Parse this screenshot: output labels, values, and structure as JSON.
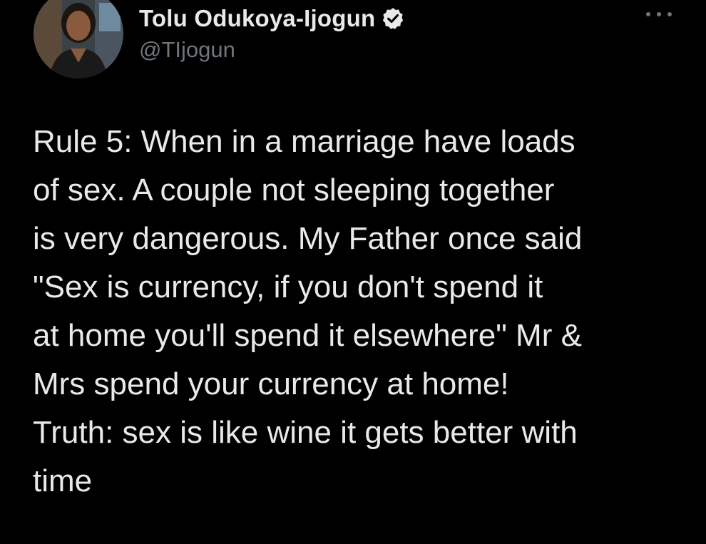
{
  "author": {
    "display_name": "Tolu Odukoya-Ijogun",
    "handle": "@TIjogun",
    "verified_icon": "verified-badge-icon",
    "avatar_icon": "profile-photo"
  },
  "menu": {
    "icon": "more-options-icon"
  },
  "tweet": {
    "lines": [
      "Rule 5: When in a marriage have loads",
      "of sex. A couple not sleeping together",
      "is very dangerous. My Father once said",
      "\"Sex is currency, if you don't spend it",
      "at home you'll spend it elsewhere\" Mr &",
      "Mrs spend your currency at home!",
      "Truth: sex is like wine it gets better with",
      "time"
    ]
  },
  "colors": {
    "background": "#000000",
    "text": "#e7e9ea",
    "secondary_text": "#71767b",
    "verified_badge": "#e7e9ea"
  }
}
